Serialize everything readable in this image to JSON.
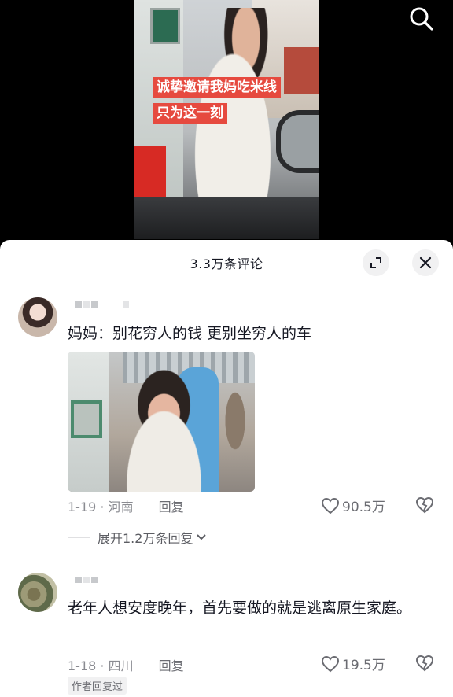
{
  "video": {
    "caption_line1": "诚挚邀请我妈吃米线",
    "caption_line2": "只为这一刻"
  },
  "top_bar": {
    "search_icon": "search-icon"
  },
  "panel": {
    "title": "3.3万条评论",
    "expand_icon": "expand-icon",
    "close_icon": "close-icon"
  },
  "comments": [
    {
      "text": "妈妈：别花穷人的钱 更别坐穷人的车",
      "date_location": "1-19 · 河南",
      "reply_label": "回复",
      "likes": "90.5万",
      "expand_replies": "展开1.2万条回复"
    },
    {
      "text": "老年人想安度晚年，首先要做的就是逃离原生家庭。",
      "date_location": "1-18 · 四川",
      "reply_label": "回复",
      "likes": "19.5万",
      "author_tag": "作者回复过"
    }
  ]
}
